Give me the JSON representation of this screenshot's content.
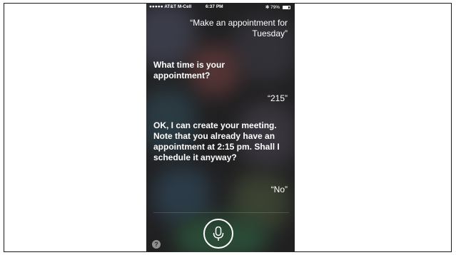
{
  "status_bar": {
    "carrier": "●●●●● AT&T M-Cell",
    "time": "6:37 PM",
    "battery_percent": "79%",
    "battery_level": 0.79
  },
  "conversation": {
    "user_request": "“Make an appointment for Tuesday”",
    "siri_question": "What time is your appointment?",
    "user_time": "“215”",
    "siri_conflict": "OK, I can create your meeting. Note that you already have an appointment at 2:15 pm. Shall I schedule it anyway?",
    "user_answer": "“No”"
  },
  "controls": {
    "mic_icon": "microphone-icon",
    "help_label": "?"
  },
  "colors": {
    "text": "#ffffff",
    "background": "#2b2a2b"
  }
}
